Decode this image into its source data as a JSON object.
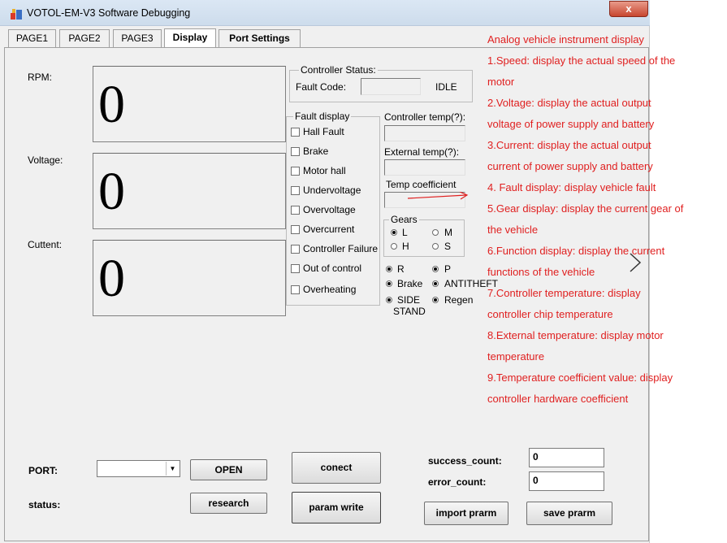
{
  "window": {
    "title": "VOTOL-EM-V3 Software Debugging",
    "close_label": "x"
  },
  "tabs": [
    "PAGE1",
    "PAGE2",
    "PAGE3",
    "Display",
    "Port Settings"
  ],
  "active_tab": "Display",
  "meters": {
    "rpm_label": "RPM:",
    "rpm_value": "0",
    "voltage_label": "Voltage:",
    "voltage_value": "0",
    "current_label": "Cuttent:",
    "current_value": "0"
  },
  "controller_status": {
    "title": "Controller Status:",
    "fault_code_label": "Fault Code:",
    "fault_code_value": "",
    "state": "IDLE"
  },
  "fault_display": {
    "title": "Fault display",
    "items": [
      "Hall Fault",
      "Brake",
      "Motor hall",
      "Undervoltage",
      "Overvoltage",
      "Overcurrent",
      "Controller Failure",
      "Out of control",
      "Overheating"
    ]
  },
  "temps": {
    "controller_label": "Controller temp(?):",
    "controller_value": "",
    "external_label": "External temp(?):",
    "external_value": "",
    "coefficient_label": "Temp coefficient",
    "coefficient_value": ""
  },
  "gears": {
    "title": "Gears",
    "options": [
      "L",
      "M",
      "H",
      "S"
    ],
    "selected": "L"
  },
  "functions": {
    "r": "R",
    "p": "P",
    "brake": "Brake",
    "antitheft": "ANTITHEFT",
    "side_stand_line1": "SIDE",
    "side_stand_line2": "STAND",
    "regen": "Regen"
  },
  "bottom": {
    "port_label": "PORT:",
    "port_value": "",
    "open_button": "OPEN",
    "status_label": "status:",
    "research_button": "research",
    "connect_button": "conect",
    "param_write_button": "param write",
    "success_label": "success_count:",
    "success_value": "0",
    "error_label": "error_count:",
    "error_value": "0",
    "import_button": "import prarm",
    "save_button": "save prarm"
  },
  "annotation": {
    "color": "#e02020",
    "lines": [
      "Analog vehicle instrument display",
      "1.Speed: display the actual speed of the",
      "motor",
      "2.Voltage: display the actual output",
      "voltage of power supply and battery",
      "3.Current: display the actual output",
      "current of power supply and battery",
      "4. Fault display: display vehicle fault",
      "5.Gear display: display the current gear of",
      "the vehicle",
      "6.Function display: display the current",
      "functions of the vehicle",
      "7.Controller temperature: display",
      "controller chip temperature",
      "8.External temperature: display motor",
      "temperature",
      "9.Temperature coefficient value: display",
      "controller hardware coefficient"
    ]
  }
}
